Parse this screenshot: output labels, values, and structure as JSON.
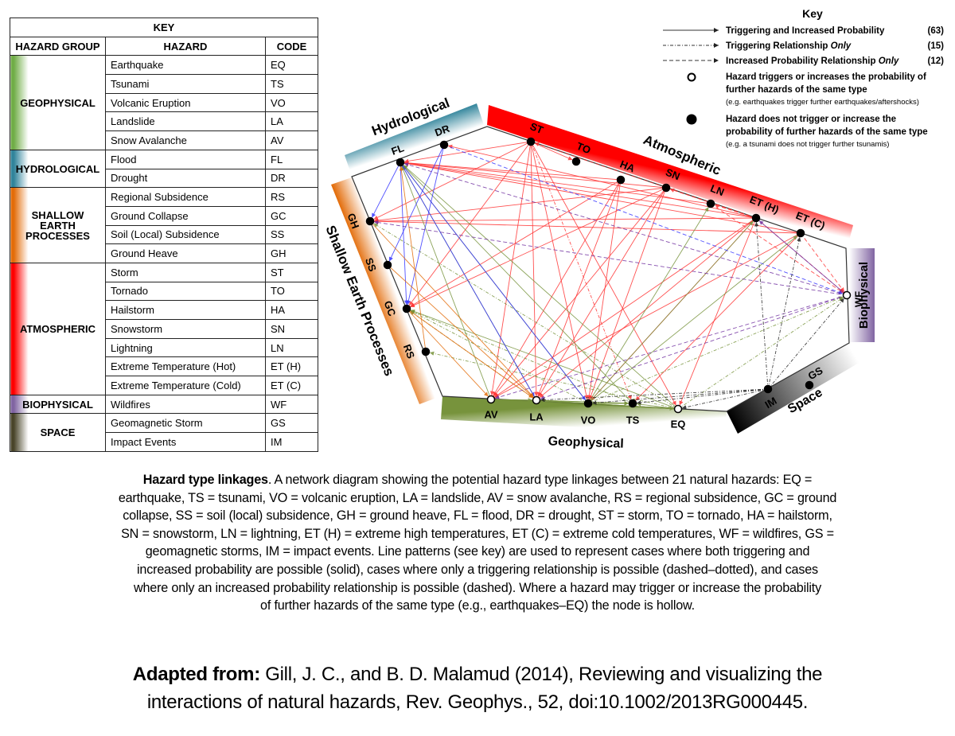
{
  "table": {
    "title": "KEY",
    "headers": [
      "HAZARD GROUP",
      "HAZARD",
      "CODE"
    ],
    "groups": [
      {
        "name": "GEOPHYSICAL",
        "color": "#70ad47",
        "rows": [
          [
            "Earthquake",
            "EQ"
          ],
          [
            "Tsunami",
            "TS"
          ],
          [
            "Volcanic Eruption",
            "VO"
          ],
          [
            "Landslide",
            "LA"
          ],
          [
            "Snow Avalanche",
            "AV"
          ]
        ]
      },
      {
        "name": "HYDROLOGICAL",
        "color": "#31849b",
        "rows": [
          [
            "Flood",
            "FL"
          ],
          [
            "Drought",
            "DR"
          ]
        ]
      },
      {
        "name": "SHALLOW EARTH PROCESSES",
        "color": "#e36c09",
        "rows": [
          [
            "Regional Subsidence",
            "RS"
          ],
          [
            "Ground Collapse",
            "GC"
          ],
          [
            "Soil (Local) Subsidence",
            "SS"
          ],
          [
            "Ground Heave",
            "GH"
          ]
        ]
      },
      {
        "name": "ATMOSPHERIC",
        "color": "#ff0000",
        "rows": [
          [
            "Storm",
            "ST"
          ],
          [
            "Tornado",
            "TO"
          ],
          [
            "Hailstorm",
            "HA"
          ],
          [
            "Snowstorm",
            "SN"
          ],
          [
            "Lightning",
            "LN"
          ],
          [
            "Extreme Temperature (Hot)",
            "ET (H)"
          ],
          [
            "Extreme Temperature (Cold)",
            "ET (C)"
          ]
        ]
      },
      {
        "name": "BIOPHYSICAL",
        "color": "#8064a2",
        "rows": [
          [
            "Wildfires",
            "WF"
          ]
        ]
      },
      {
        "name": "SPACE",
        "color": "#4a452a",
        "rows": [
          [
            "Geomagnetic Storm",
            "GS"
          ],
          [
            "Impact Events",
            "IM"
          ]
        ]
      }
    ]
  },
  "legend": {
    "title": "Key",
    "line_types": [
      {
        "style": "solid",
        "label": "Triggering and Increased Probability",
        "italic": "",
        "count": "(63)"
      },
      {
        "style": "dashdot",
        "label": "Triggering Relationship ",
        "italic": "Only",
        "count": "(15)"
      },
      {
        "style": "dashed",
        "label": "Increased Probability Relationship ",
        "italic": "Only",
        "count": "(12)"
      }
    ],
    "hollow": {
      "title": [
        "Hazard triggers or increases the probability of",
        "further hazards of the same type"
      ],
      "example": "(e.g. earthquakes trigger further earthquakes/aftershocks)"
    },
    "filled": {
      "title": [
        "Hazard does not trigger or increase the",
        "probability of further hazards of the same type"
      ],
      "example": "(e.g. a tsunami does not trigger further tsunamis)"
    }
  },
  "diagram": {
    "groups": [
      {
        "id": "hydro",
        "label": "Hydrological",
        "color": "#31849b"
      },
      {
        "id": "atmo",
        "label": "Atmospheric",
        "color": "#ff0000"
      },
      {
        "id": "shallow",
        "label": "Shallow Earth Processes",
        "color": "#e36c09"
      },
      {
        "id": "bio",
        "label": "Biophysical",
        "color": "#8064a2"
      },
      {
        "id": "geo",
        "label": "Geophysical",
        "color": "#77933c"
      },
      {
        "id": "space",
        "label": "Space",
        "color": "#000000"
      }
    ],
    "nodes": [
      {
        "code": "FL",
        "group": "hydro",
        "hollow": false
      },
      {
        "code": "DR",
        "group": "hydro",
        "hollow": false
      },
      {
        "code": "ST",
        "group": "atmo",
        "hollow": false
      },
      {
        "code": "TO",
        "group": "atmo",
        "hollow": false
      },
      {
        "code": "HA",
        "group": "atmo",
        "hollow": false
      },
      {
        "code": "SN",
        "group": "atmo",
        "hollow": false
      },
      {
        "code": "LN",
        "group": "atmo",
        "hollow": false
      },
      {
        "code": "ET (H)",
        "group": "atmo",
        "hollow": false
      },
      {
        "code": "ET (C)",
        "group": "atmo",
        "hollow": false
      },
      {
        "code": "WF",
        "group": "bio",
        "hollow": true
      },
      {
        "code": "GS",
        "group": "space",
        "hollow": false
      },
      {
        "code": "IM",
        "group": "space",
        "hollow": false
      },
      {
        "code": "EQ",
        "group": "geo",
        "hollow": true
      },
      {
        "code": "TS",
        "group": "geo",
        "hollow": false
      },
      {
        "code": "VO",
        "group": "geo",
        "hollow": false
      },
      {
        "code": "LA",
        "group": "geo",
        "hollow": true
      },
      {
        "code": "AV",
        "group": "geo",
        "hollow": true
      },
      {
        "code": "RS",
        "group": "shallow",
        "hollow": false
      },
      {
        "code": "GC",
        "group": "shallow",
        "hollow": false
      },
      {
        "code": "SS",
        "group": "shallow",
        "hollow": false
      },
      {
        "code": "GH",
        "group": "shallow",
        "hollow": false
      }
    ],
    "edge_colors": {
      "hydro": "#3333ff",
      "atmo": "#ff3333",
      "shallow": "#e36c09",
      "bio": "#7030a0",
      "geo": "#77933c",
      "space": "#222222"
    },
    "edges": [
      [
        "ST",
        "FL",
        "solid"
      ],
      [
        "ST",
        "LA",
        "solid"
      ],
      [
        "ST",
        "AV",
        "solid"
      ],
      [
        "ST",
        "GC",
        "solid"
      ],
      [
        "ST",
        "GH",
        "solid"
      ],
      [
        "ST",
        "TO",
        "solid"
      ],
      [
        "ST",
        "VO",
        "solid"
      ],
      [
        "ST",
        "TS",
        "dashdot"
      ],
      [
        "ST",
        "EQ",
        "solid"
      ],
      [
        "HA",
        "FL",
        "solid"
      ],
      [
        "HA",
        "LA",
        "solid"
      ],
      [
        "HA",
        "AV",
        "solid"
      ],
      [
        "HA",
        "GC",
        "solid"
      ],
      [
        "HA",
        "VO",
        "solid"
      ],
      [
        "SN",
        "FL",
        "solid"
      ],
      [
        "SN",
        "AV",
        "solid"
      ],
      [
        "SN",
        "LA",
        "solid"
      ],
      [
        "SN",
        "GC",
        "solid"
      ],
      [
        "SN",
        "GH",
        "solid"
      ],
      [
        "SN",
        "VO",
        "solid"
      ],
      [
        "LN",
        "WF",
        "dashed"
      ],
      [
        "LN",
        "FL",
        "solid"
      ],
      [
        "ET (H)",
        "DR",
        "solid"
      ],
      [
        "ET (H)",
        "WF",
        "dashed"
      ],
      [
        "ET (H)",
        "AV",
        "solid"
      ],
      [
        "ET (H)",
        "LA",
        "solid"
      ],
      [
        "ET (H)",
        "FL",
        "solid"
      ],
      [
        "ET (H)",
        "GH",
        "solid"
      ],
      [
        "ET (H)",
        "VO",
        "solid"
      ],
      [
        "ET (H)",
        "EQ",
        "solid"
      ],
      [
        "ET (H)",
        "ST",
        "dashed"
      ],
      [
        "ET (H)",
        "LN",
        "dashed"
      ],
      [
        "ET (H)",
        "SN",
        "dashed"
      ],
      [
        "ET (C)",
        "GH",
        "solid"
      ],
      [
        "ET (C)",
        "FL",
        "solid"
      ],
      [
        "ET (C)",
        "AV",
        "solid"
      ],
      [
        "ET (C)",
        "WF",
        "dashed"
      ],
      [
        "ET (C)",
        "TS",
        "solid"
      ],
      [
        "EQ",
        "LA",
        "solid"
      ],
      [
        "EQ",
        "AV",
        "solid"
      ],
      [
        "EQ",
        "TS",
        "solid"
      ],
      [
        "EQ",
        "VO",
        "solid"
      ],
      [
        "EQ",
        "FL",
        "solid"
      ],
      [
        "EQ",
        "GC",
        "solid"
      ],
      [
        "EQ",
        "RS",
        "dashdot"
      ],
      [
        "EQ",
        "WF",
        "dashdot"
      ],
      [
        "EQ",
        "GH",
        "dashdot"
      ],
      [
        "VO",
        "LA",
        "solid"
      ],
      [
        "VO",
        "TS",
        "solid"
      ],
      [
        "VO",
        "FL",
        "solid"
      ],
      [
        "VO",
        "EQ",
        "solid"
      ],
      [
        "VO",
        "LN",
        "solid"
      ],
      [
        "VO",
        "ET (C)",
        "solid"
      ],
      [
        "VO",
        "ET (H)",
        "solid"
      ],
      [
        "VO",
        "WF",
        "dashdot"
      ],
      [
        "VO",
        "GC",
        "dashdot"
      ],
      [
        "VO",
        "AV",
        "solid"
      ],
      [
        "TS",
        "FL",
        "solid"
      ],
      [
        "TS",
        "LA",
        "solid"
      ],
      [
        "TS",
        "GC",
        "dashdot"
      ],
      [
        "LA",
        "FL",
        "solid"
      ],
      [
        "LA",
        "TS",
        "solid"
      ],
      [
        "LA",
        "AV",
        "solid"
      ],
      [
        "LA",
        "GC",
        "dashdot"
      ],
      [
        "AV",
        "FL",
        "solid"
      ],
      [
        "AV",
        "LA",
        "solid"
      ],
      [
        "FL",
        "GH",
        "solid"
      ],
      [
        "FL",
        "LA",
        "solid"
      ],
      [
        "FL",
        "GC",
        "solid"
      ],
      [
        "FL",
        "VO",
        "solid"
      ],
      [
        "DR",
        "SS",
        "solid"
      ],
      [
        "DR",
        "GC",
        "solid"
      ],
      [
        "DR",
        "WF",
        "dashed"
      ],
      [
        "GC",
        "LA",
        "solid"
      ],
      [
        "GC",
        "AV",
        "solid"
      ],
      [
        "SS",
        "LA",
        "solid"
      ],
      [
        "RS",
        "FL",
        "solid"
      ],
      [
        "GH",
        "LA",
        "solid"
      ],
      [
        "WF",
        "FL",
        "dashed"
      ],
      [
        "WF",
        "GH",
        "dashed"
      ],
      [
        "WF",
        "ET (H)",
        "solid"
      ],
      [
        "WF",
        "LA",
        "dashed"
      ],
      [
        "WF",
        "AV",
        "dashed"
      ],
      [
        "IM",
        "EQ",
        "dashdot"
      ],
      [
        "IM",
        "TS",
        "dashdot"
      ],
      [
        "IM",
        "VO",
        "dashdot"
      ],
      [
        "IM",
        "WF",
        "dashdot"
      ],
      [
        "IM",
        "ET (C)",
        "dashdot"
      ],
      [
        "IM",
        "LA",
        "dashdot"
      ],
      [
        "IM",
        "ET (H)",
        "dashdot"
      ]
    ]
  },
  "caption": {
    "bold": "Hazard type linkages",
    "lines": [
      ". A network diagram showing the potential hazard type linkages between 21 natural hazards: EQ =",
      "earthquake, TS = tsunami, VO = volcanic eruption, LA = landslide, AV = snow avalanche, RS = regional subsidence, GC = ground",
      "collapse, SS = soil (local) subsidence, GH = ground heave, FL = flood, DR = drought, ST = storm, TO = tornado, HA = hailstorm,",
      "SN = snowstorm, LN = lightning, ET (H) = extreme high temperatures, ET (C) = extreme cold temperatures, WF = wildfires, GS =",
      "geomagnetic storms, IM = impact events. Line patterns (see key) are used to represent cases where both triggering and",
      "increased probability are possible (solid), cases where only a triggering relationship is possible (dashed–dotted), and cases",
      "where only an increased probability relationship is possible (dashed). Where a hazard may trigger or increase the probability",
      "of further hazards of the same type (e.g., earthquakes–EQ) the node is hollow."
    ]
  },
  "citation": {
    "bold": "Adapted from:",
    "lines": [
      " Gill, J. C., and B. D. Malamud (2014), Reviewing and visualizing the",
      "interactions of natural hazards, Rev. Geophys., 52, doi:10.1002/2013RG000445."
    ]
  }
}
